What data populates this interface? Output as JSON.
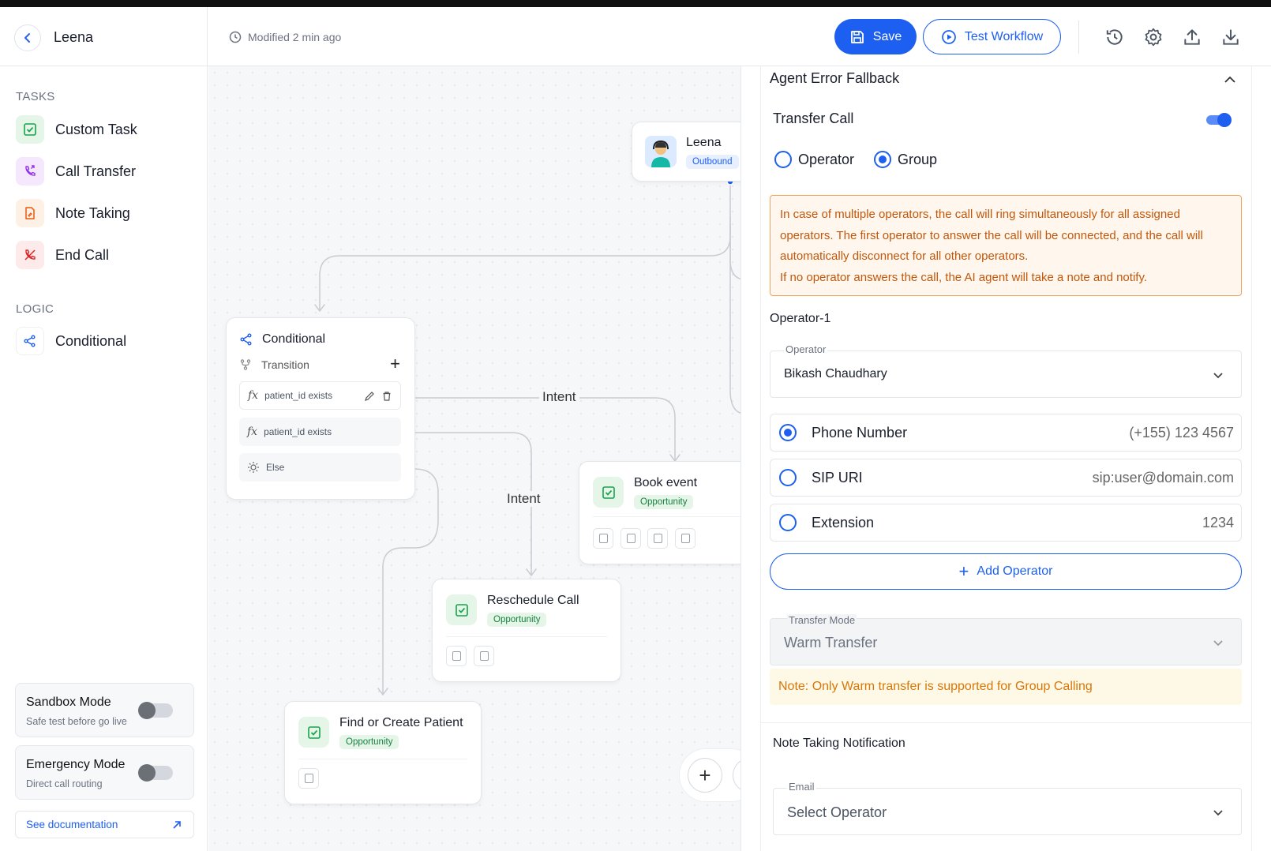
{
  "header": {
    "app_title": "Leena",
    "modified": "Modified 2 min ago",
    "save_label": "Save",
    "test_label": "Test Workflow",
    "accent": "#1d5ff0"
  },
  "sidebar": {
    "tasks_label": "TASKS",
    "tasks": [
      {
        "label": "Custom Task",
        "icon": "checkbox-icon",
        "color": "#16a34a"
      },
      {
        "label": "Call Transfer",
        "icon": "phone-transfer-icon",
        "color": "#9333ea"
      },
      {
        "label": "Note Taking",
        "icon": "note-icon",
        "color": "#ea580c"
      },
      {
        "label": "End Call",
        "icon": "end-call-icon",
        "color": "#dc2626"
      }
    ],
    "logic_label": "LOGIC",
    "logic": [
      {
        "label": "Conditional",
        "icon": "branch-icon",
        "color": "#1d5ff0"
      }
    ],
    "sandbox": {
      "title": "Sandbox Mode",
      "subtitle": "Safe test before go live",
      "enabled": false
    },
    "emergency": {
      "title": "Emergency Mode",
      "subtitle": "Direct call routing",
      "enabled": false
    },
    "doc_link": "See documentation"
  },
  "canvas": {
    "agent_node": {
      "name": "Leena",
      "badge": "Outbound"
    },
    "conditional_node": {
      "title": "Conditional",
      "transition_label": "Transition",
      "rows": [
        "patient_id exists",
        "patient_id exists",
        "Else"
      ]
    },
    "edge_labels": [
      "Intent",
      "Intent"
    ],
    "book_event": {
      "title": "Book event",
      "badge": "Opportunity"
    },
    "reschedule": {
      "title": "Reschedule Call",
      "badge": "Opportunity"
    },
    "find_patient": {
      "title": "Find or Create Patient",
      "badge": "Opportunity"
    },
    "fab": "+"
  },
  "panel": {
    "title": "Agent Error Fallback",
    "transfer_call_label": "Transfer Call",
    "transfer_call_enabled": true,
    "radio_operator": "Operator",
    "radio_group": "Group",
    "selected_target": "Group",
    "warning_line1": "In case of multiple operators, the call will ring simultaneously for all assigned operators. The first operator to answer the call will be connected, and the call will automatically disconnect for all other operators.",
    "warning_line2": "If no operator answers the call, the AI agent will take a note and notify.",
    "operator_heading": "Operator-1",
    "operator_field_label": "Operator",
    "operator_value": "Bikash Chaudhary",
    "phone_options": [
      {
        "label": "Phone Number",
        "value": "(+155) 123 4567",
        "selected": true
      },
      {
        "label": "SIP URI",
        "value": "sip:user@domain.com",
        "selected": false
      },
      {
        "label": "Extension",
        "value": "1234",
        "selected": false
      }
    ],
    "add_operator": "Add Operator",
    "transfer_mode_label": "Transfer Mode",
    "transfer_mode_value": "Warm Transfer",
    "note": "Note: Only Warm transfer is supported for Group Calling",
    "note_taking_heading": "Note Taking Notification",
    "email_label": "Email",
    "email_placeholder": "Select Operator"
  }
}
